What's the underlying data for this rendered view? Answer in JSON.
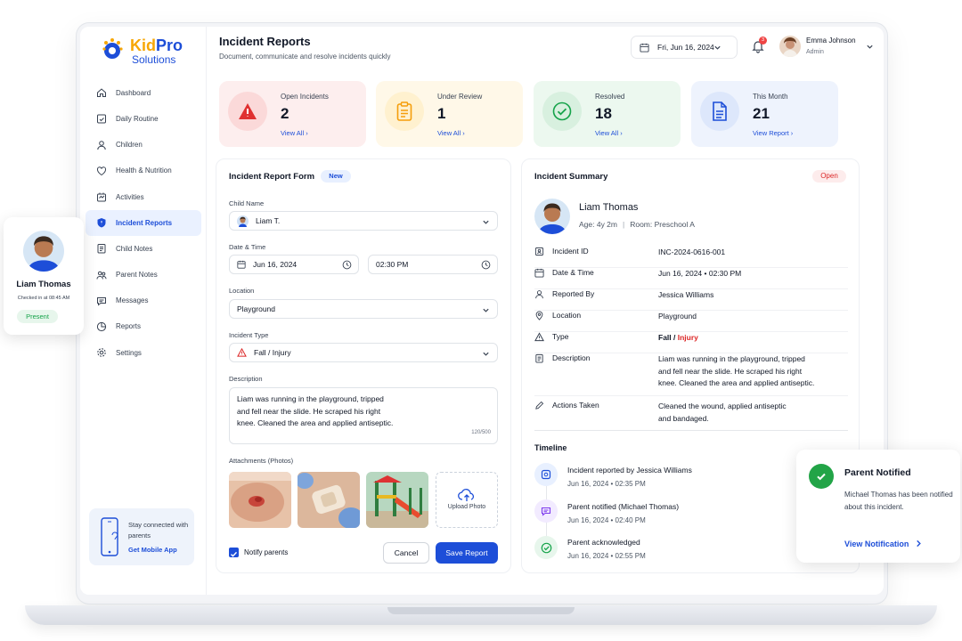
{
  "app": {
    "brand_top": "Kid",
    "brand_top2": "Pro",
    "brand_sub": "Solutions"
  },
  "header": {
    "title": "Incident Reports",
    "subtitle": "Document, communicate and resolve incidents quickly",
    "date": "Fri, Jun 16, 2024",
    "notifications": "3",
    "user_name": "Emma Johnson",
    "user_role": "Admin"
  },
  "sidebar": {
    "items": [
      {
        "label": "Dashboard",
        "icon": "home-icon"
      },
      {
        "label": "Daily Routine",
        "icon": "calendar-check-icon"
      },
      {
        "label": "Children",
        "icon": "person-icon"
      },
      {
        "label": "Health & Nutrition",
        "icon": "heart-icon"
      },
      {
        "label": "Activities",
        "icon": "activity-icon"
      },
      {
        "label": "Incident Reports",
        "icon": "shield-icon"
      },
      {
        "label": "Child Notes",
        "icon": "note-icon"
      },
      {
        "label": "Parent Notes",
        "icon": "parent-icon"
      },
      {
        "label": "Messages",
        "icon": "message-icon"
      },
      {
        "label": "Reports",
        "icon": "report-icon"
      },
      {
        "label": "Settings",
        "icon": "gear-icon"
      }
    ],
    "active": "Incident Reports",
    "promo_text": "Stay connected with parents",
    "promo_link": "Get Mobile App"
  },
  "stats": [
    {
      "label": "Open Incidents",
      "value": "2",
      "link": "View All",
      "color": "#fdeeee",
      "accent": "#dc2626"
    },
    {
      "label": "Under Review",
      "value": "1",
      "link": "View All",
      "color": "#fff8e8",
      "accent": "#f59e0b"
    },
    {
      "label": "Resolved",
      "value": "18",
      "link": "View All",
      "color": "#ecf8ef",
      "accent": "#16a34a"
    },
    {
      "label": "This Month",
      "value": "21",
      "link": "View Report",
      "color": "#eef3fd",
      "accent": "#1d4ed8"
    }
  ],
  "form": {
    "title": "Incident Report Form",
    "badge": "New",
    "child_label": "Child Name",
    "child_value": "Liam T.",
    "datetime_label": "Date & Time",
    "date_value": "Jun 16, 2024",
    "time_value": "02:30 PM",
    "location_label": "Location",
    "location_value": "Playground",
    "type_label": "Incident Type",
    "type_value": "Fall / Injury",
    "desc_label": "Description",
    "desc_line1": "Liam was running in the playground, tripped",
    "desc_line2": "and fell near the slide. He scraped his right",
    "desc_line3": "knee. Cleaned the area and applied antiseptic.",
    "desc_count": "120/500",
    "attach_label": "Attachments (Photos)",
    "upload_label": "Upload Photo",
    "notify_label": "Notify parents",
    "notify_checked": true,
    "cancel": "Cancel",
    "save": "Save Report"
  },
  "summary": {
    "title": "Incident Summary",
    "status": "Open",
    "child_name": "Liam Thomas",
    "age": "Age: 4y 2m",
    "room": "Room: Preschool A",
    "rows": {
      "id_k": "Incident ID",
      "id_v": "INC-2024-0616-001",
      "dt_k": "Date & Time",
      "dt_v": "Jun 16, 2024  •  02:30 PM",
      "by_k": "Reported By",
      "by_v": "Jessica Williams",
      "loc_k": "Location",
      "loc_v": "Playground",
      "type_k": "Type",
      "type_v1": "Fall",
      "type_sep": " / ",
      "type_v2": "Injury",
      "desc_k": "Description",
      "desc_v1": "Liam was running in the playground, tripped",
      "desc_v2": "and fell near the slide. He scraped his right",
      "desc_v3": "knee. Cleaned the area and applied antiseptic.",
      "act_k": "Actions Taken",
      "act_v1": "Cleaned the wound, applied antiseptic",
      "act_v2": "and bandaged."
    },
    "timeline_title": "Timeline",
    "timeline": [
      {
        "text": "Incident reported by Jessica Williams",
        "date": "Jun 16, 2024  •  02:35 PM"
      },
      {
        "text": "Parent notified (Michael Thomas)",
        "date": "Jun 16, 2024  •  02:40 PM"
      },
      {
        "text": "Parent acknowledged",
        "date": "Jun 16, 2024  •  02:55 PM"
      }
    ]
  },
  "checkin_card": {
    "name": "Liam Thomas",
    "checked": "Checked in at 08:45 AM",
    "status": "Present"
  },
  "notify_card": {
    "title": "Parent Notified",
    "body": "Michael Thomas has been notified about this incident.",
    "link": "View Notification"
  }
}
